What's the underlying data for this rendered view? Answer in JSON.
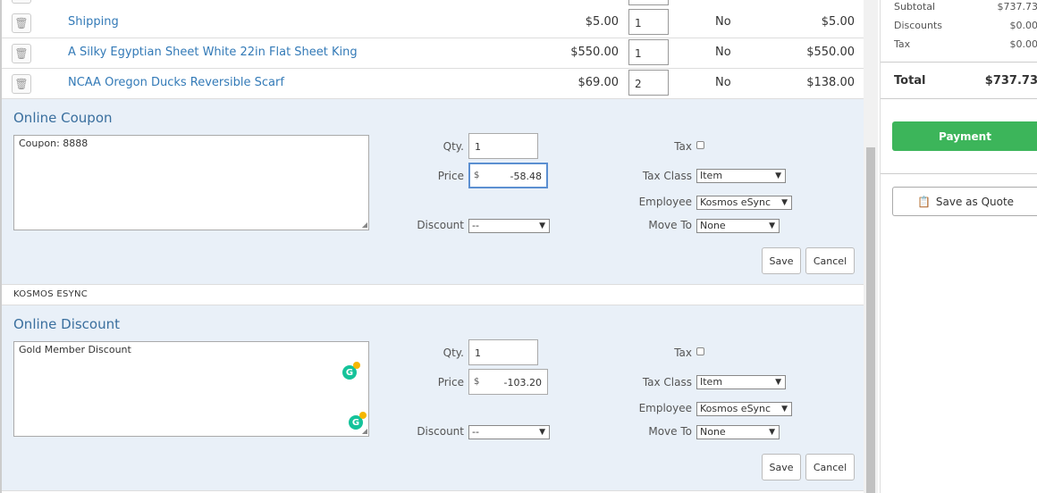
{
  "items": [
    {
      "name": "Shipping",
      "price": "$5.00",
      "qty": "1",
      "tax": "No",
      "total": "$5.00"
    },
    {
      "name": "A Silky Egyptian Sheet White 22in Flat Sheet King",
      "price": "$550.00",
      "qty": "1",
      "tax": "No",
      "total": "$550.00"
    },
    {
      "name": "NCAA Oregon Ducks Reversible Scarf",
      "price": "$69.00",
      "qty": "2",
      "tax": "No",
      "total": "$138.00"
    }
  ],
  "coupon": {
    "title": "Online Coupon",
    "description": "Coupon: 8888",
    "qty_label": "Qty.",
    "qty": "1",
    "price_label": "Price",
    "currency": "$",
    "price": "-58.48",
    "discount_label": "Discount",
    "discount": "--",
    "tax_label": "Tax",
    "tax_class_label": "Tax Class",
    "tax_class": "Item",
    "employee_label": "Employee",
    "employee": "Kosmos eSync",
    "move_to_label": "Move To",
    "move_to": "None",
    "save": "Save",
    "cancel": "Cancel"
  },
  "employee_header": "KOSMOS ESYNC",
  "discount_item": {
    "title": "Online Discount",
    "description": "Gold Member Discount",
    "qty_label": "Qty.",
    "qty": "1",
    "price_label": "Price",
    "currency": "$",
    "price": "-103.20",
    "discount_label": "Discount",
    "discount": "--",
    "tax_label": "Tax",
    "tax_class_label": "Tax Class",
    "tax_class": "Item",
    "employee_label": "Employee",
    "employee": "Kosmos eSync",
    "move_to_label": "Move To",
    "move_to": "None",
    "save": "Save",
    "cancel": "Cancel"
  },
  "summary": {
    "subtotal_label": "Subtotal",
    "subtotal": "$737.73",
    "discounts_label": "Discounts",
    "discounts": "$0.00",
    "tax_label": "Tax",
    "tax": "$0.00",
    "total_label": "Total",
    "total": "$737.73",
    "payment_button": "Payment",
    "quote_button": "Save as Quote"
  },
  "colors": {
    "accent": "#337ab7",
    "payment": "#3cb55a",
    "panel": "#e9f0f8"
  }
}
